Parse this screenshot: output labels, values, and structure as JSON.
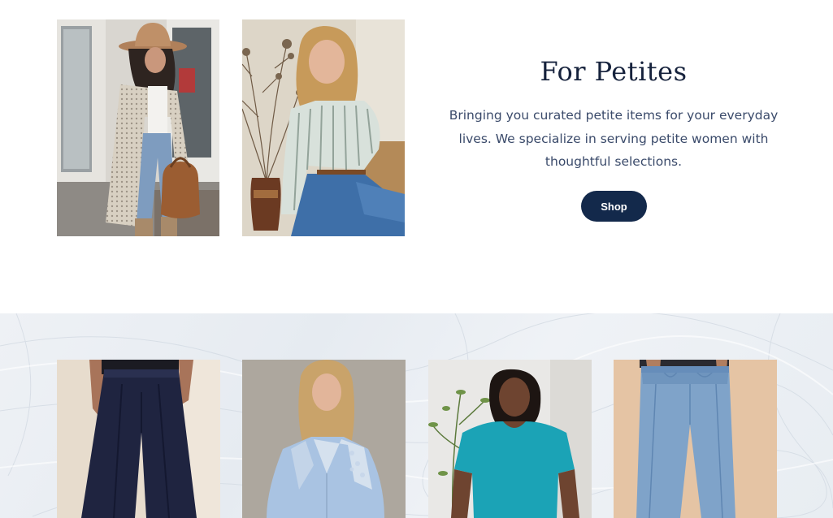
{
  "intro": {
    "title": "For Petites",
    "description": "Bringing you curated petite items for your everyday lives. We specialize in serving petite women with thoughtful selections.",
    "shop_label": "Shop"
  },
  "colors": {
    "navy": "#13294b",
    "heading": "#16223c",
    "body_text": "#3a4a6a",
    "marble_bg": "#eceff3"
  },
  "hero_photos": [
    {
      "subject": "woman-in-hat-with-kimono-and-brown-bag"
    },
    {
      "subject": "woman-in-striped-blouse-sitting"
    }
  ],
  "products": [
    {
      "subject": "navy-wide-leg-pants"
    },
    {
      "subject": "blue-lace-blouse"
    },
    {
      "subject": "teal-tshirt"
    },
    {
      "subject": "light-wash-flare-jeans"
    }
  ]
}
